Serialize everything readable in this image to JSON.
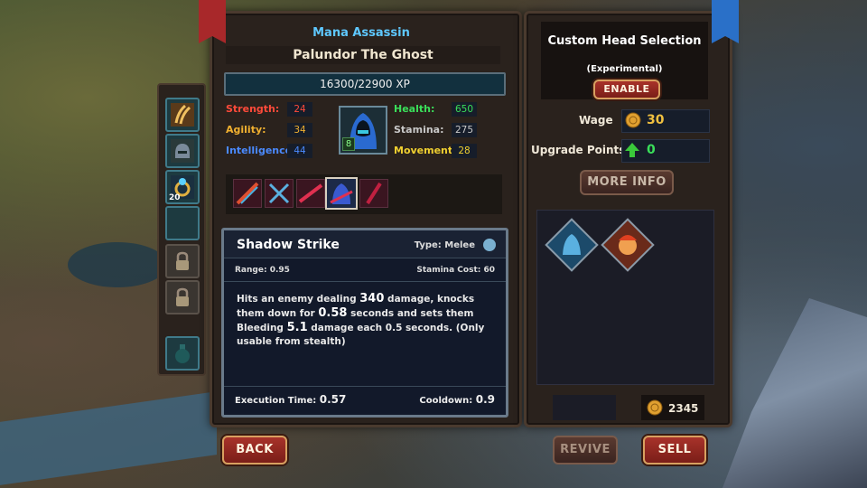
{
  "hero": {
    "class_name": "Mana Assassin",
    "name": "Palundor The Ghost",
    "xp": "16300/22900 XP",
    "level": "8",
    "stats_left": [
      {
        "label": "Strength:",
        "value": "24",
        "color": "#ff4a3a"
      },
      {
        "label": "Agility:",
        "value": "34",
        "color": "#f0b030"
      },
      {
        "label": "Intelligence:",
        "value": "44",
        "color": "#4a8aff"
      }
    ],
    "stats_right": [
      {
        "label": "Health:",
        "value": "650",
        "color": "#3adf5a"
      },
      {
        "label": "Stamina:",
        "value": "275",
        "color": "#c8c8c8"
      },
      {
        "label": "Movement:",
        "value": "28",
        "color": "#f0d030"
      }
    ]
  },
  "side_slots": [
    {
      "icon": "claw-slashes-icon"
    },
    {
      "icon": "helmet-icon"
    },
    {
      "icon": "ring-icon",
      "count": "20"
    },
    {
      "icon": "empty-slot"
    },
    {
      "icon": "padlock-icon"
    },
    {
      "icon": "padlock-icon"
    },
    {
      "icon": "potion-icon"
    }
  ],
  "skill": {
    "name": "Shadow Strike",
    "type": "Type: Melee",
    "range": "Range: 0.95",
    "stamina_cost": "Stamina Cost: 60",
    "desc_1": "Hits an enemy dealing ",
    "desc_damage": "340",
    "desc_2": " damage, knocks them down for ",
    "desc_down": "0.58",
    "desc_3": " seconds and sets them Bleeding ",
    "desc_bleed": "5.1",
    "desc_4": " damage each 0.5 seconds. (Only usable from stealth)",
    "exec_label": "Execution Time: ",
    "exec_value": "0.57",
    "cooldown_label": "Cooldown: ",
    "cooldown_value": "0.9"
  },
  "buttons": {
    "back": "BACK",
    "revive": "REVIVE",
    "sell": "SELL",
    "enable": "ENABLE",
    "more_info": "MORE INFO"
  },
  "custom_head": {
    "title": "Custom Head Selection",
    "subtitle": "(Experimental)"
  },
  "wage": {
    "label": "Wage",
    "value": "30"
  },
  "upgrade_points": {
    "label": "Upgrade Points",
    "value": "0"
  },
  "gold": "2345",
  "colors": {
    "accent_blue": "#5ec8ff",
    "button_red": "#a8322a",
    "gold": "#f0b030"
  }
}
